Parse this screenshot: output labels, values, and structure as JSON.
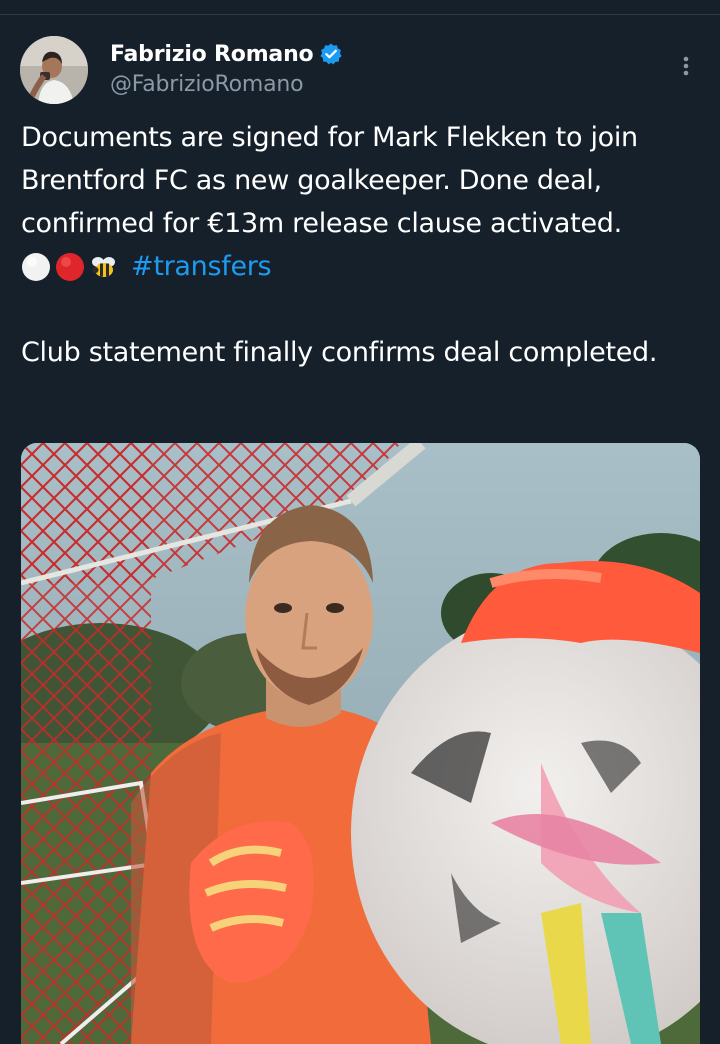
{
  "author": {
    "display_name": "Fabrizio Romano",
    "handle": "@FabrizioRomano",
    "verified": true,
    "verified_icon": "verified-badge-icon",
    "verified_color": "#1d9bf0"
  },
  "tweet": {
    "paragraph1": "Documents are signed for Mark Flekken to join Brentford FC as new goalkeeper. Done deal, confirmed for €13m release clause activated.",
    "emojis": [
      "white-circle-icon",
      "red-circle-icon",
      "bee-icon"
    ],
    "hashtag": "#transfers",
    "paragraph2": "Club statement finally confirms deal completed."
  },
  "media": {
    "icon": "photo-goalkeeper-with-ball"
  },
  "colors": {
    "background": "#15202b",
    "text": "#ffffff",
    "secondary_text": "#8b98a5",
    "link": "#1d9bf0"
  }
}
